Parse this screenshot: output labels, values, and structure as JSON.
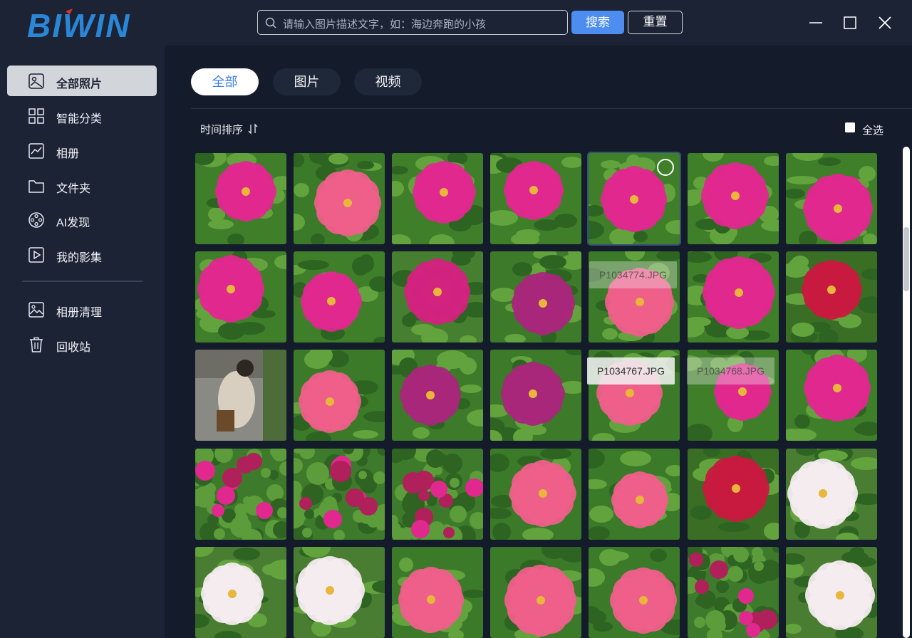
{
  "app": {
    "logo_text": "BIWIN"
  },
  "search": {
    "placeholder": "请输入图片描述文字，如：海边奔跑的小孩",
    "search_label": "搜索",
    "reset_label": "重置"
  },
  "sidebar": {
    "items": [
      {
        "label": "全部照片",
        "icon": "photo-icon",
        "active": true
      },
      {
        "label": "智能分类",
        "icon": "grid-icon",
        "active": false
      },
      {
        "label": "相册",
        "icon": "chart-album-icon",
        "active": false
      },
      {
        "label": "文件夹",
        "icon": "folder-icon",
        "active": false
      },
      {
        "label": "AI发现",
        "icon": "film-reel-icon",
        "active": false
      },
      {
        "label": "我的影集",
        "icon": "play-box-icon",
        "active": false
      },
      {
        "label": "相册清理",
        "icon": "image-icon",
        "active": false
      },
      {
        "label": "回收站",
        "icon": "trash-icon",
        "active": false
      }
    ]
  },
  "main": {
    "tabs": [
      {
        "label": "全部"
      },
      {
        "label": "图片"
      },
      {
        "label": "视频"
      }
    ],
    "sort_label": "时间排序",
    "select_all_label": "全选",
    "tooltips": {
      "row2_col5": "P1034774.JPG",
      "row3_col5": "P1034767.JPG",
      "row3_col6": "P1034768.JPG"
    }
  },
  "colors": {
    "accent": "#4d8df0",
    "magenta": "#e0288f",
    "leaf": "#3f8a2e",
    "sidebar_bg": "#1b2335",
    "main_bg": "#141c2b"
  }
}
